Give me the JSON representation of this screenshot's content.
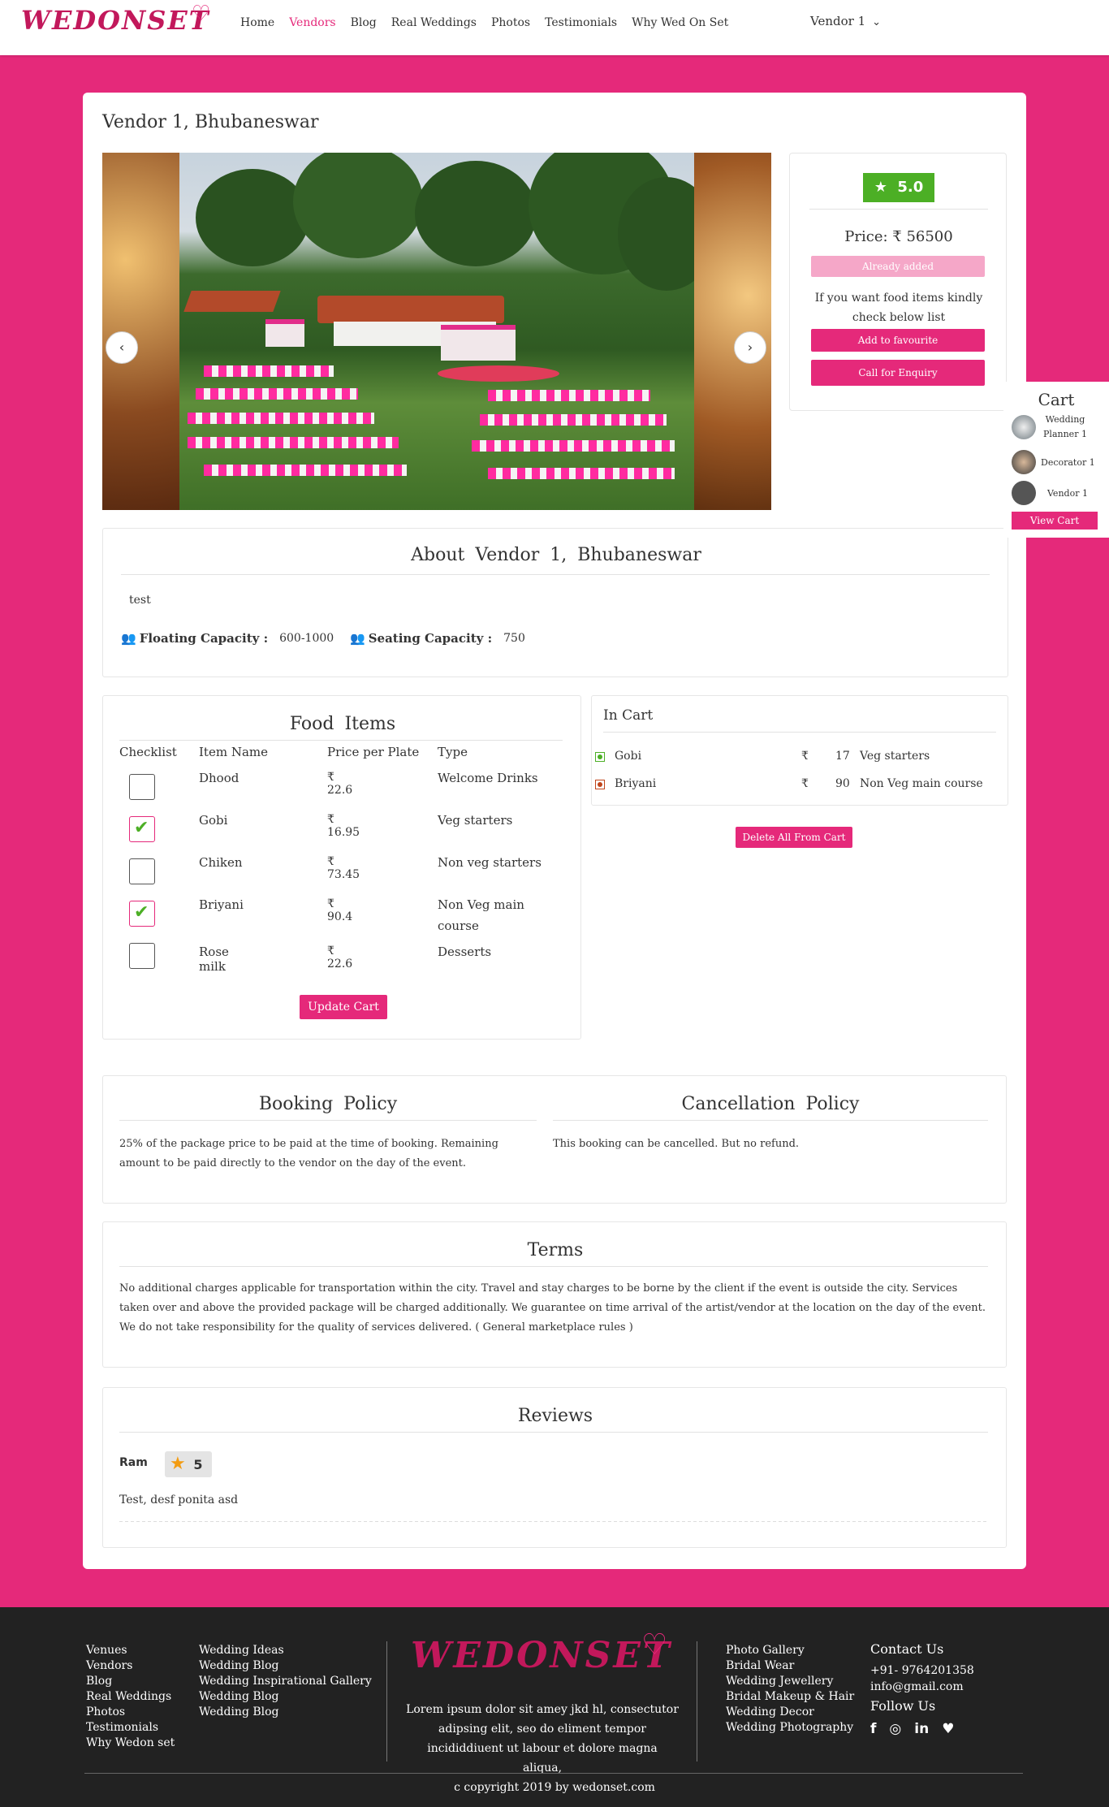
{
  "brand": {
    "logo_text": "WEDONSET"
  },
  "nav": {
    "links": [
      "Home",
      "Vendors",
      "Blog",
      "Real Weddings",
      "Photos",
      "Testimonials",
      "Why Wed On Set"
    ],
    "active_index": 1,
    "user_label": "Vendor 1",
    "chevron_icon": "chevron-down-icon"
  },
  "vendor": {
    "title": "Vendor 1, Bhubaneswar"
  },
  "carousel": {
    "prev_label": "‹",
    "next_label": "›"
  },
  "pricing": {
    "rating": "5.0",
    "rating_icon": "star-icon",
    "price_label": "Price: ₹ 56500",
    "already_added": "Already added",
    "food_note": "If you want food items kindly check below list",
    "fav_button": "Add to favourite",
    "enquiry_button": "Call for Enquiry"
  },
  "cart_widget": {
    "title": "Cart",
    "items": [
      "Wedding Planner 1",
      "Decorator 1",
      "Vendor 1"
    ],
    "view_button": "View Cart"
  },
  "about": {
    "heading": "About Vendor 1, Bhubaneswar",
    "text": "test",
    "floating_label": "Floating Capacity :",
    "floating_value": "600-1000",
    "seating_label": "Seating Capacity :",
    "seating_value": "750"
  },
  "food": {
    "heading": "Food Items",
    "columns": [
      "Checklist",
      "Item Name",
      "Price per Plate",
      "Type"
    ],
    "rows": [
      {
        "name": "Dhood",
        "price": "₹ 22.6",
        "type": "Welcome Drinks",
        "checked": false
      },
      {
        "name": "Gobi",
        "price": "₹ 16.95",
        "type": "Veg starters",
        "checked": true
      },
      {
        "name": "Chiken",
        "price": "₹ 73.45",
        "type": "Non veg starters",
        "checked": false
      },
      {
        "name": "Briyani",
        "price": "₹ 90.4",
        "type": "Non Veg main course",
        "checked": true
      },
      {
        "name": "Rose milk",
        "price": "₹ 22.6",
        "type": "Desserts",
        "checked": false
      }
    ],
    "update_button": "Update Cart"
  },
  "in_cart": {
    "heading": "In Cart",
    "rows": [
      {
        "name": "Gobi",
        "currency": "₹",
        "amount": "17",
        "type": "Veg starters",
        "veg": true
      },
      {
        "name": "Briyani",
        "currency": "₹",
        "amount": "90",
        "type": "Non Veg main course",
        "veg": false
      }
    ],
    "delete_button": "Delete All From Cart"
  },
  "policy": {
    "booking_heading": "Booking Policy",
    "booking_text": "25% of the package price to be paid at the time of booking. Remaining amount to be paid directly to the vendor on the day of the event.",
    "cancel_heading": "Cancellation Policy",
    "cancel_text": "This booking can be cancelled. But no refund."
  },
  "terms": {
    "heading": "Terms",
    "text": "No additional charges applicable for transportation within the city. Travel and stay charges to be borne by the client if the event is outside the city. Services taken over and above the provided package will be charged additionally. We guarantee on time arrival of the artist/vendor at the location on the day of the event. We do not take responsibility for the quality of services delivered. ( General marketplace rules )"
  },
  "reviews": {
    "heading": "Reviews",
    "items": [
      {
        "author": "Ram",
        "rating": "5",
        "text": "Test, desf ponita asd"
      }
    ]
  },
  "footer": {
    "col1": [
      "Venues",
      "Vendors",
      "Blog",
      "Real Weddings",
      "Photos",
      "Testimonials",
      "Why Wedon set"
    ],
    "col2": [
      "Wedding Ideas",
      "Wedding Blog",
      "Wedding Inspirational Gallery",
      "Wedding Blog",
      "Wedding Blog"
    ],
    "logo_text": "WEDONSET",
    "blurb": "Lorem ipsum dolor sit amey jkd hl, consectutor adipsing elit, seo do eliment tempor incididdiuent ut labour et dolore magna aliqua,",
    "col3": [
      "Photo Gallery",
      "Bridal Wear",
      "Wedding Jewellery",
      "Bridal Makeup & Hair",
      "Wedding Decor",
      "Wedding Photography"
    ],
    "contact_heading": "Contact Us",
    "phone": "+91- 9764201358",
    "email": "info@gmail.com",
    "follow_heading": "Follow Us",
    "social_icons": [
      "facebook-icon",
      "instagram-icon",
      "linkedin-icon",
      "twitter-icon"
    ],
    "copyright": "c copyright 2019 by wedonset.com"
  },
  "colors": {
    "brand_pink": "#e5297a",
    "rating_green": "#4caf25",
    "footer_bg": "#222222"
  }
}
